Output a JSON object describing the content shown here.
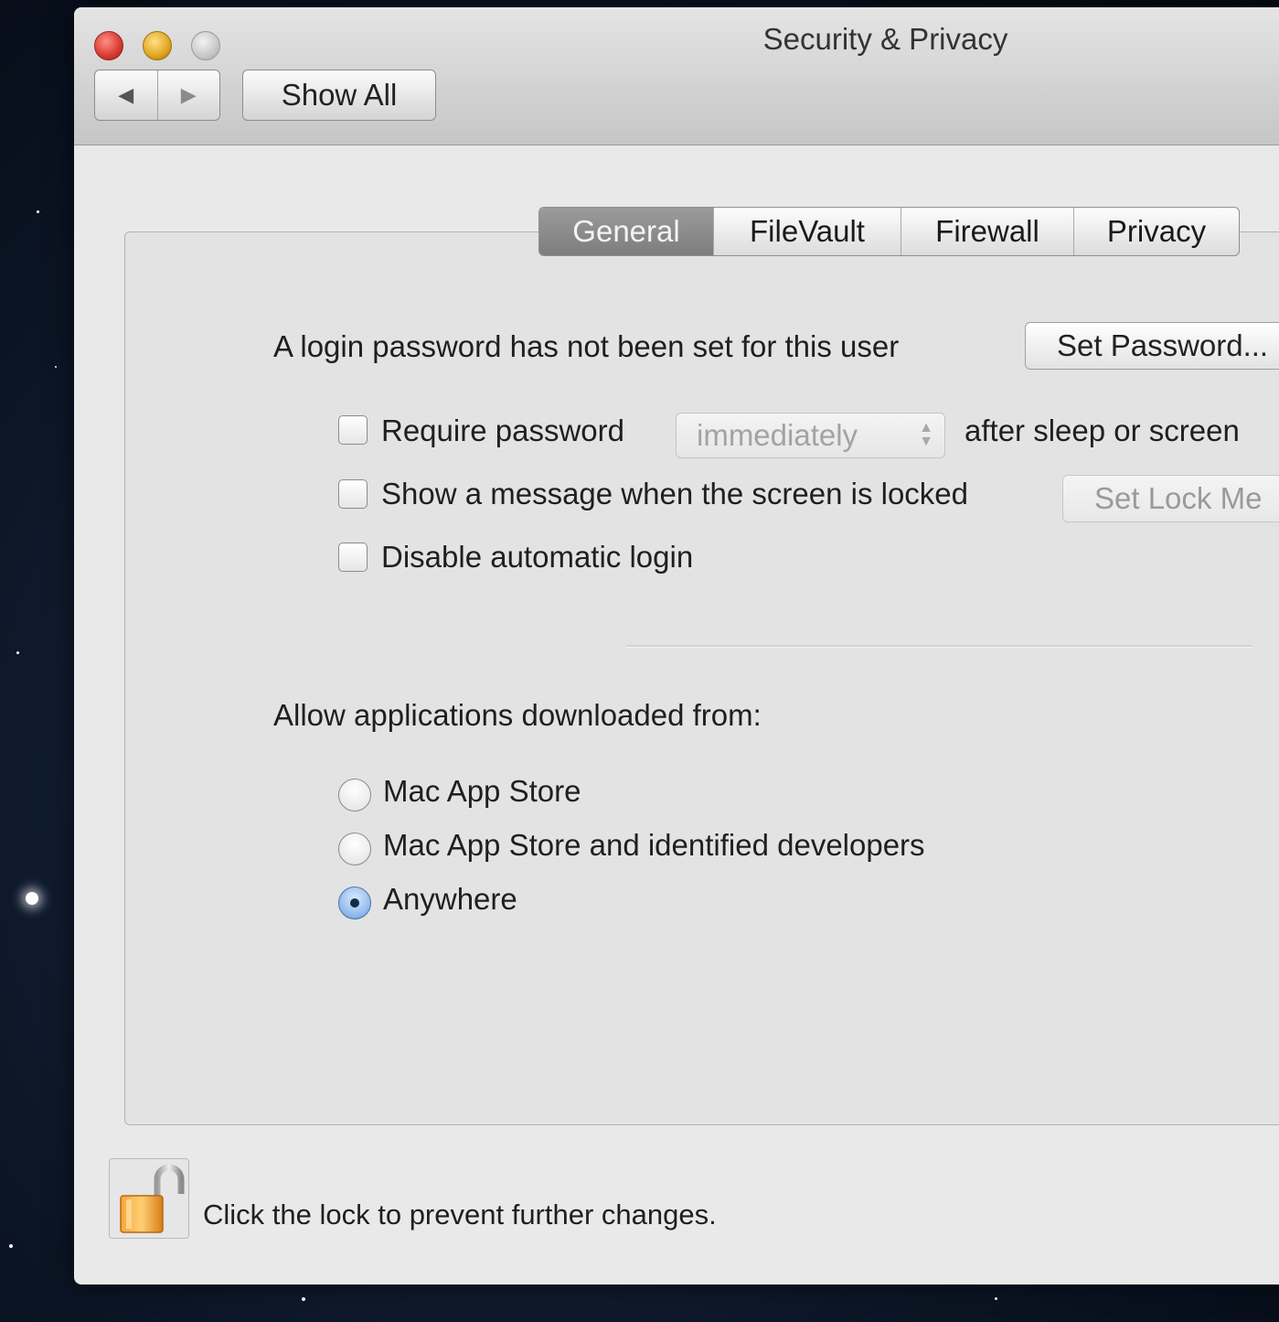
{
  "window": {
    "title": "Security & Privacy",
    "show_all_label": "Show All",
    "back_glyph": "◀",
    "forward_glyph": "▶"
  },
  "tabs": [
    {
      "label": "General",
      "active": true
    },
    {
      "label": "FileVault",
      "active": false
    },
    {
      "label": "Firewall",
      "active": false
    },
    {
      "label": "Privacy",
      "active": false
    }
  ],
  "general": {
    "login_password_text": "A login password has not been set for this user",
    "set_password_button": "Set Password...",
    "require_password": {
      "label": "Require password",
      "checked": false,
      "select_value": "immediately",
      "suffix": "after sleep or screen"
    },
    "show_message": {
      "label": "Show a message when the screen is locked",
      "checked": false,
      "button": "Set Lock Me"
    },
    "disable_auto_login": {
      "label": "Disable automatic login",
      "checked": false
    },
    "allow_apps_label": "Allow applications downloaded from:",
    "allow_apps_options": [
      {
        "label": "Mac App Store",
        "selected": false
      },
      {
        "label": "Mac App Store and identified developers",
        "selected": false
      },
      {
        "label": "Anywhere",
        "selected": true
      }
    ]
  },
  "footer": {
    "lock_text": "Click the lock to prevent further changes.",
    "lock_icon": "unlocked-padlock-icon"
  },
  "colors": {
    "active_tab": "#8a8a8a",
    "radio_selected": "#8cb7ea",
    "close_button": "#d9392f",
    "minimize_button": "#e0a51c"
  }
}
